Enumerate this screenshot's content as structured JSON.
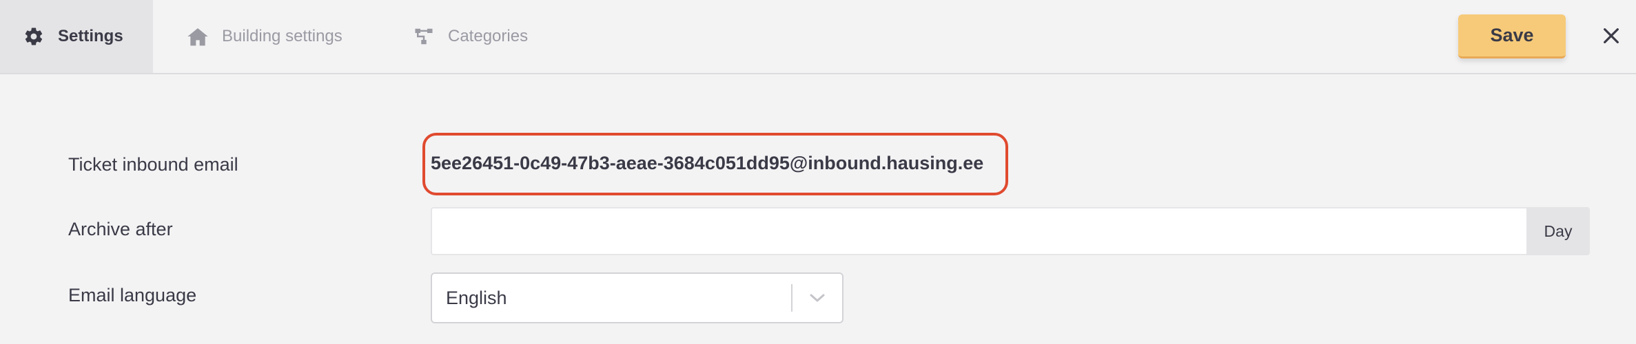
{
  "tabs": [
    {
      "label": "Settings",
      "icon": "gear-icon",
      "active": true
    },
    {
      "label": "Building settings",
      "icon": "home-icon",
      "active": false
    },
    {
      "label": "Categories",
      "icon": "hierarchy-icon",
      "active": false
    }
  ],
  "toolbar": {
    "save_label": "Save",
    "close_icon": "close-icon"
  },
  "form": {
    "inbound_email": {
      "label": "Ticket inbound email",
      "value": "5ee26451-0c49-47b3-aeae-3684c051dd95@inbound.hausing.ee"
    },
    "archive_after": {
      "label": "Archive after",
      "value": "",
      "unit": "Day"
    },
    "email_language": {
      "label": "Email language",
      "value": "English"
    }
  },
  "colors": {
    "save_button": "#f6ca79",
    "highlight": "#e04a2f",
    "background": "#f3f3f4",
    "active_tab": "#e4e4e6"
  }
}
